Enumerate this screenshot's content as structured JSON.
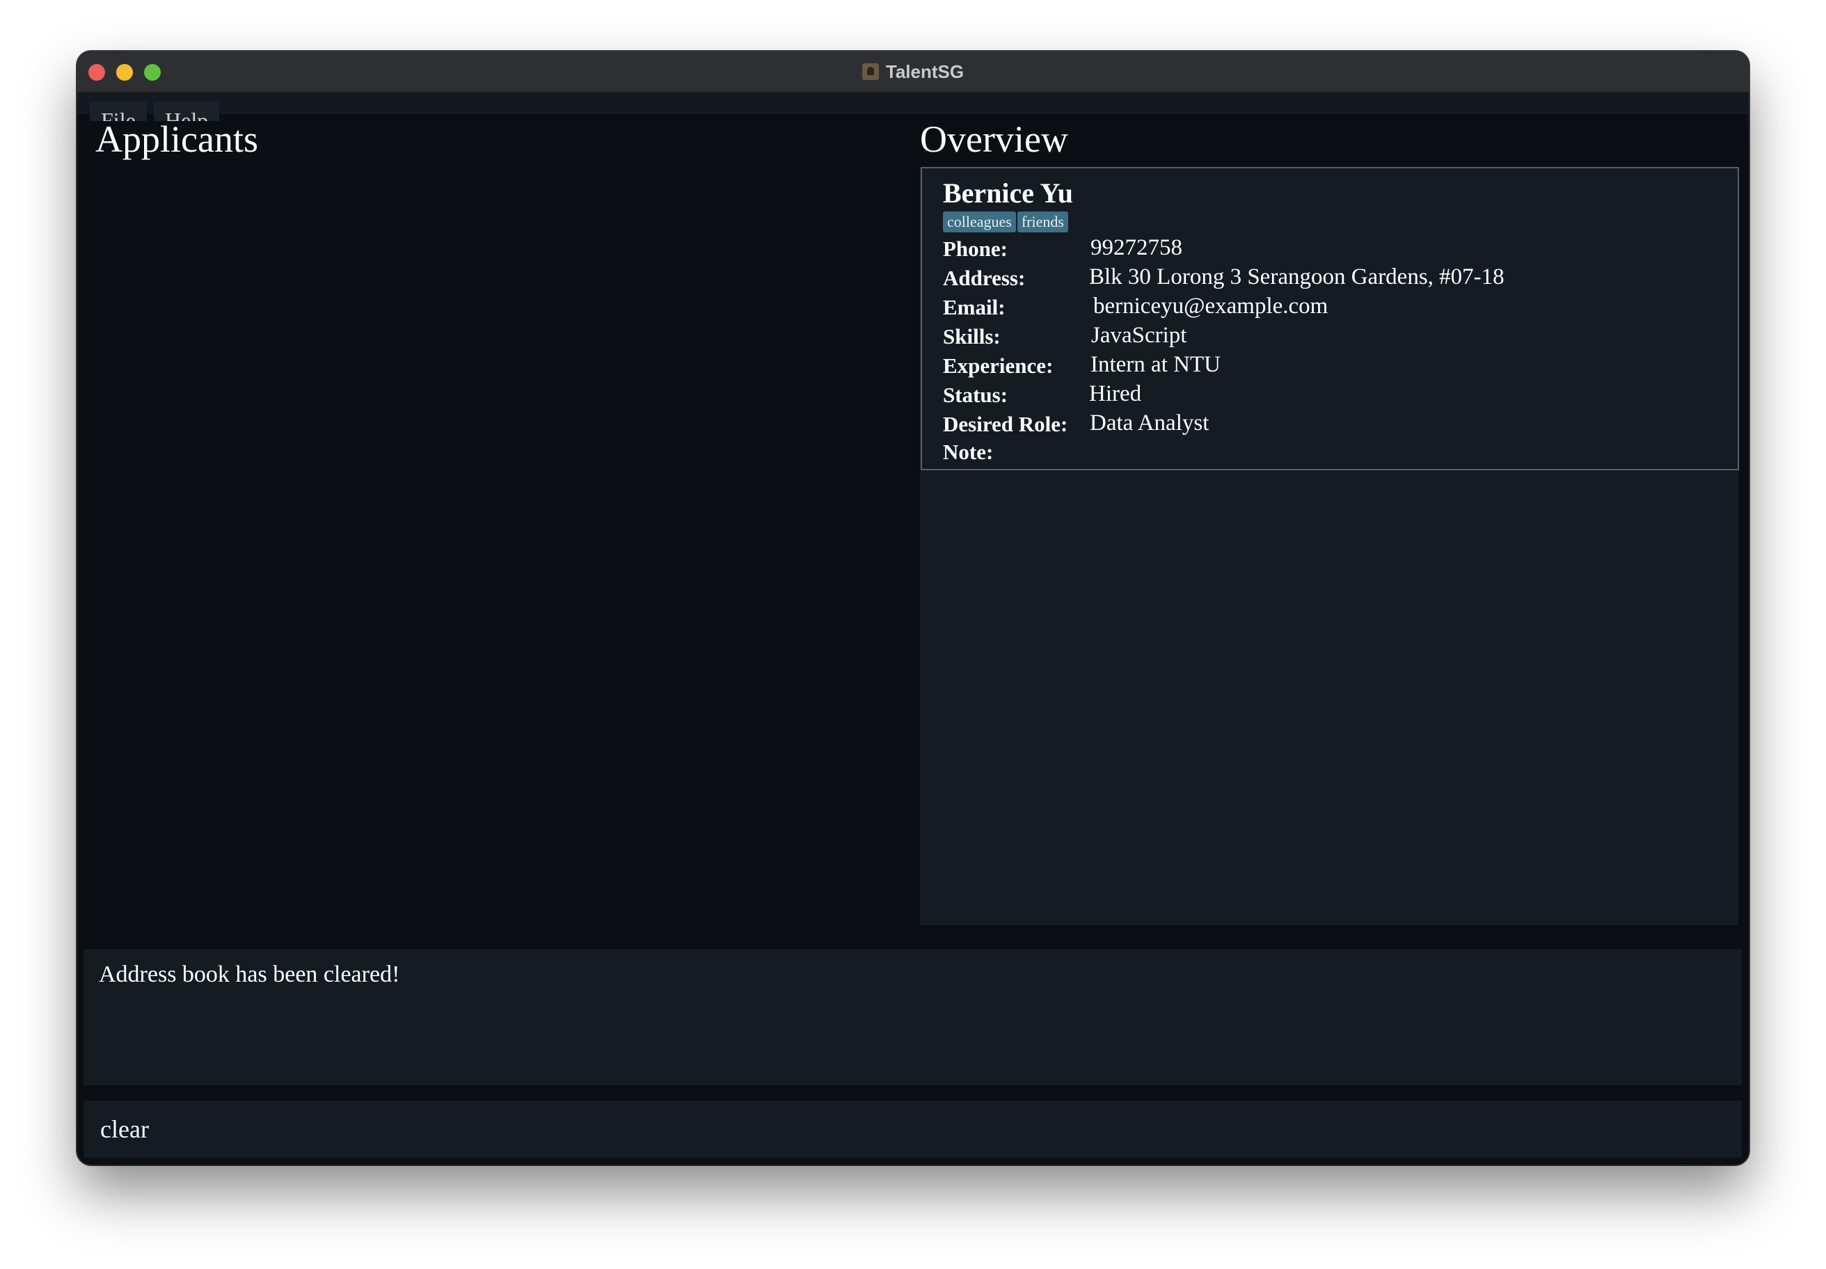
{
  "window": {
    "title": "TalentSG"
  },
  "menu": {
    "file": "File",
    "help": "Help"
  },
  "applicants": {
    "heading": "Applicants"
  },
  "overview": {
    "heading": "Overview",
    "person": {
      "name": "Bernice Yu",
      "tags": [
        "colleagues",
        "friends"
      ],
      "fields": {
        "phone": {
          "label": "Phone:",
          "value": "99272758"
        },
        "address": {
          "label": "Address:",
          "value": "Blk 30 Lorong 3 Serangoon Gardens, #07-18"
        },
        "email": {
          "label": "Email:",
          "value": "berniceyu@example.com"
        },
        "skills": {
          "label": "Skills:",
          "value": "JavaScript"
        },
        "experience": {
          "label": "Experience:",
          "value": "Intern at NTU"
        },
        "status": {
          "label": "Status:",
          "value": "Hired"
        },
        "desired_role": {
          "label": "Desired Role:",
          "value": "Data Analyst"
        },
        "note": {
          "label": "Note:",
          "value": ""
        }
      }
    }
  },
  "result": {
    "message": "Address book has been cleared!"
  },
  "command": {
    "value": "clear"
  },
  "colors": {
    "background": "#0b0e12",
    "panel": "#151b23",
    "tag": "#3d6f85",
    "text": "#ffffff"
  }
}
